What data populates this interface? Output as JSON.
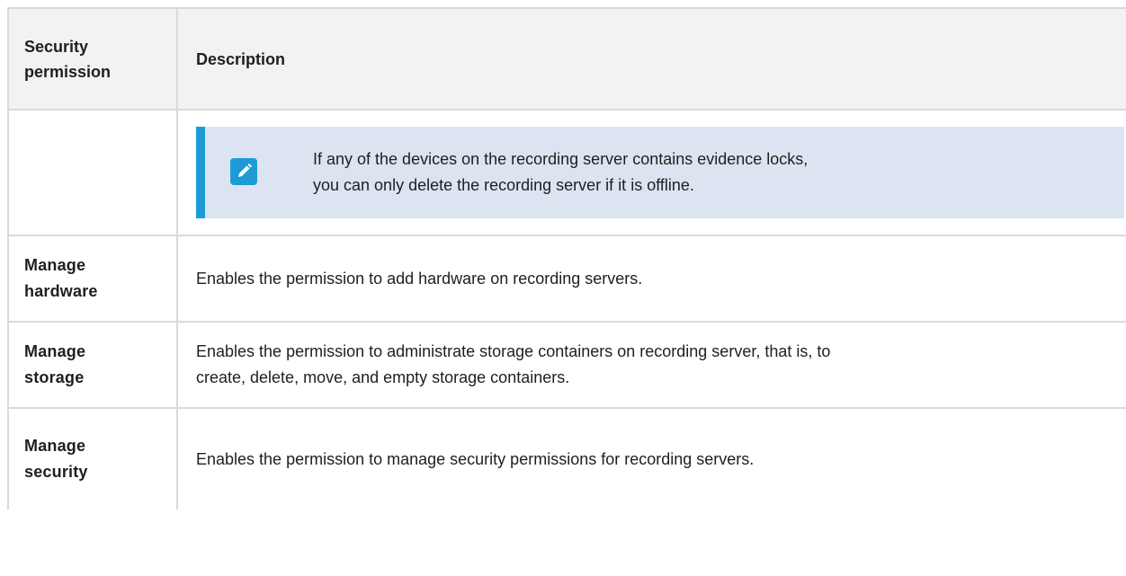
{
  "table": {
    "header": {
      "permission": "Security permission",
      "description": "Description"
    },
    "note": {
      "icon": "pencil-icon",
      "line1": "If any of the devices on the recording server contains evidence locks,",
      "line2": "you can only delete the recording server if it is offline."
    },
    "rows": [
      {
        "permission_line1": "Manage",
        "permission_line2": "hardware",
        "description": "Enables the permission to add hardware on recording servers."
      },
      {
        "permission_line1": "Manage",
        "permission_line2": "storage",
        "description_line1": "Enables the permission to administrate storage containers on recording server, that is, to",
        "description_line2": "create, delete, move, and empty storage containers."
      },
      {
        "permission_line1": "Manage",
        "permission_line2": "security",
        "description": "Enables the permission to manage security permissions for recording servers."
      }
    ]
  },
  "colors": {
    "header_bg": "#f2f2f2",
    "border": "#d9d9d9",
    "note_bg": "#dce4f2",
    "note_accent": "#1e9bd7"
  }
}
